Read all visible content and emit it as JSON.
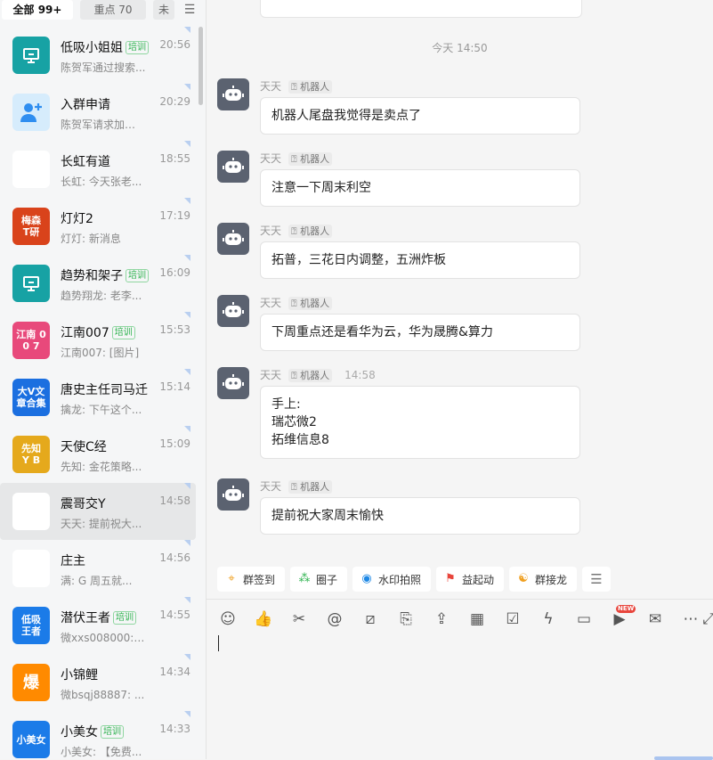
{
  "tabs": [
    {
      "label": "全部 99+",
      "active": true
    },
    {
      "label": "重点 70",
      "active": false
    },
    {
      "label": "未",
      "active": false
    }
  ],
  "conversations": [
    {
      "name": "低吸小姐姐",
      "badge": "培训",
      "time": "20:56",
      "preview": "陈贺军通过搜索...",
      "avatar_text": "",
      "avatar_icon": "presentation-icon",
      "avatar_color": "#17a2a4"
    },
    {
      "name": "入群申请",
      "badge": "",
      "time": "20:29",
      "preview": "陈贺军请求加入 ...",
      "avatar_text": "",
      "avatar_icon": "add-user-icon",
      "avatar_color": "#d6ecfc"
    },
    {
      "name": "长虹有道",
      "badge": "",
      "time": "18:55",
      "preview": "长虹: 今天张老...",
      "avatar_text": "",
      "avatar_icon": "group-grid-icon",
      "avatar_color": "#ffffff"
    },
    {
      "name": "灯灯2",
      "badge": "",
      "time": "17:19",
      "preview": "灯灯: 新消息",
      "avatar_text": "梅森\nT研",
      "avatar_icon": "",
      "avatar_color": "#d9431b"
    },
    {
      "name": "趋势和架子",
      "badge": "培训",
      "time": "16:09",
      "preview": "趋势翔龙: 老李...",
      "avatar_text": "",
      "avatar_icon": "presentation-icon",
      "avatar_color": "#17a2a4"
    },
    {
      "name": "江南007",
      "badge": "培训",
      "time": "15:53",
      "preview": "江南007: [图片]",
      "avatar_text": "江南 0\n0 7",
      "avatar_icon": "",
      "avatar_color": "#e8497b"
    },
    {
      "name": "唐史主任司马迁",
      "badge": "",
      "time": "15:14",
      "preview": "擒龙: 下午这个...",
      "avatar_text": "大V文\n章合集",
      "avatar_icon": "",
      "avatar_color": "#1b6fe0"
    },
    {
      "name": "天使C经",
      "badge": "",
      "time": "15:09",
      "preview": "先知: 金花策略...",
      "avatar_text": "先知\nY B",
      "avatar_icon": "",
      "avatar_color": "#e5a91c"
    },
    {
      "name": "震哥交Y",
      "badge": "",
      "time": "14:58",
      "preview": "天天: 提前祝大...",
      "avatar_text": "",
      "avatar_icon": "group-grid-icon",
      "avatar_color": "#ffffff"
    },
    {
      "name": "庄主",
      "badge": "",
      "time": "14:56",
      "preview": "满: G      周五就...",
      "avatar_text": "",
      "avatar_icon": "group-grid-icon",
      "avatar_color": "#ffffff"
    },
    {
      "name": "潜伏王者",
      "badge": "培训",
      "time": "14:55",
      "preview": "微xxs008000: [...",
      "avatar_text": "低吸\n王者",
      "avatar_icon": "",
      "avatar_color": "#1b7be8"
    },
    {
      "name": "小锦鲤",
      "badge": "",
      "time": "14:34",
      "preview": "微bsqj88887: ...",
      "avatar_text": "爆",
      "avatar_icon": "",
      "avatar_color": "#ff8a00"
    },
    {
      "name": "小美女",
      "badge": "培训",
      "time": "14:33",
      "preview": "小美女: 【免费...",
      "avatar_text": "小美女",
      "avatar_icon": "",
      "avatar_color": "#1b7be8"
    }
  ],
  "chat": {
    "time_divider": "今天 14:50",
    "robot_tag": "机器人",
    "messages": [
      {
        "sender": "天天",
        "time": "",
        "lines": [
          "机器人尾盘我觉得是卖点了"
        ]
      },
      {
        "sender": "天天",
        "time": "",
        "lines": [
          "注意一下周末利空"
        ]
      },
      {
        "sender": "天天",
        "time": "",
        "lines": [
          "拓普，三花日内调整，五洲炸板"
        ]
      },
      {
        "sender": "天天",
        "time": "",
        "lines": [
          "下周重点还是看华为云，华为晟腾&算力"
        ]
      },
      {
        "sender": "天天",
        "time": "14:58",
        "lines": [
          "手上:",
          "瑞芯微2",
          "拓维信息8"
        ]
      },
      {
        "sender": "天天",
        "time": "",
        "lines": [
          "提前祝大家周末愉快"
        ]
      }
    ]
  },
  "quick_actions": [
    {
      "label": "群签到",
      "icon": "location-pin-icon",
      "color": "#f0a020"
    },
    {
      "label": "圈子",
      "icon": "circle-nodes-icon",
      "color": "#2bb24c"
    },
    {
      "label": "水印拍照",
      "icon": "camera-icon",
      "color": "#1e88e5"
    },
    {
      "label": "益起动",
      "icon": "runner-icon",
      "color": "#e8453c"
    },
    {
      "label": "群接龙",
      "icon": "dragon-icon",
      "color": "#f0a020"
    }
  ],
  "composer": {
    "new_badge": "NEW",
    "tools": [
      "emoji-icon",
      "thumbs-up-icon",
      "scissors-icon",
      "at-icon",
      "slash-icon",
      "doc-plus-icon",
      "upload-icon",
      "calendar-icon",
      "checkbox-icon",
      "lightning-icon",
      "video-camera-icon",
      "live-video-icon",
      "mail-icon",
      "more-icon",
      "expand-icon"
    ]
  }
}
